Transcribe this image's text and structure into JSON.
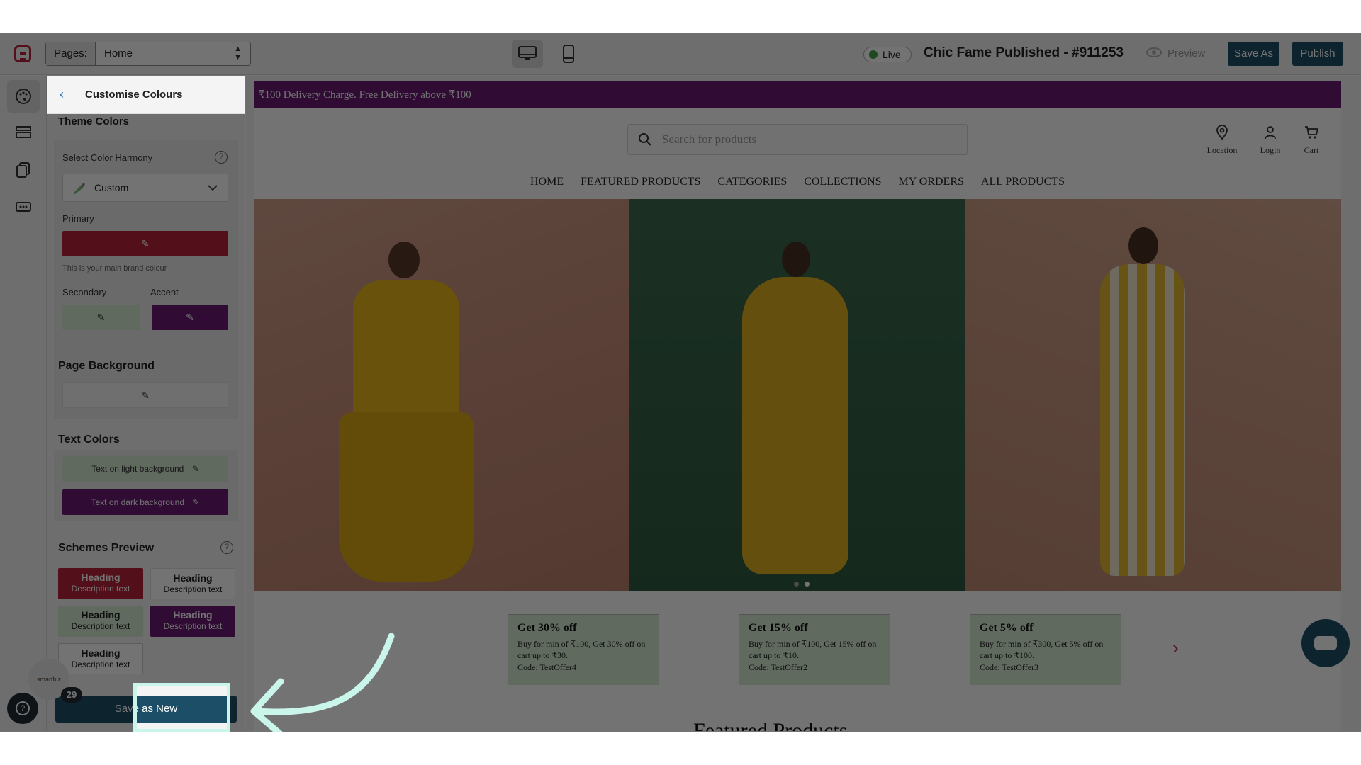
{
  "topbar": {
    "pages_label": "Pages:",
    "page_value": "Home",
    "live_label": "Live",
    "store_title": "Chic Fame Published - #911253",
    "preview_label": "Preview",
    "save_as_label": "Save As",
    "publish_label": "Publish"
  },
  "panel": {
    "title": "Customise Colours",
    "section_cut": "Theme Colors",
    "harmony_label": "Select Color Harmony",
    "harmony_value": "Custom",
    "primary_label": "Primary",
    "primary_hint": "This is your main brand colour",
    "secondary_label": "Secondary",
    "accent_label": "Accent",
    "page_bg_title": "Page Background",
    "text_colors_title": "Text Colors",
    "text_light": "Text on light background",
    "text_dark": "Text on dark background",
    "schemes_title": "Schemes Preview",
    "schemes": [
      {
        "heading": "Heading",
        "desc": "Description text"
      },
      {
        "heading": "Heading",
        "desc": "Description text"
      },
      {
        "heading": "Heading",
        "desc": "Description text"
      },
      {
        "heading": "Heading",
        "desc": "Description text"
      },
      {
        "heading": "Heading",
        "desc": "Description text"
      }
    ],
    "save_new_label": "Save as New",
    "avatar_text": "smartbiz",
    "badge_count": "29"
  },
  "colors": {
    "primary": "#b8243a",
    "secondary": "#d6ecd2",
    "accent": "#6a1c77",
    "brand_dark": "#1d4e67",
    "live_green": "#43a047"
  },
  "site": {
    "promo": "₹100 Delivery Charge. Free Delivery above ₹100",
    "search_placeholder": "Search for products",
    "header_icons": [
      {
        "icon": "location-icon",
        "label": "Location"
      },
      {
        "icon": "user-icon",
        "label": "Login"
      },
      {
        "icon": "cart-icon",
        "label": "Cart"
      }
    ],
    "nav": [
      "HOME",
      "FEATURED PRODUCTS",
      "CATEGORIES",
      "COLLECTIONS",
      "MY ORDERS",
      "ALL PRODUCTS"
    ],
    "offers": [
      {
        "title": "Get 30% off",
        "body": "Buy for min of ₹100, Get 30% off on cart up to ₹30.",
        "code": "Code: TestOffer4"
      },
      {
        "title": "Get 15% off",
        "body": "Buy for min of ₹100, Get 15% off on cart up to ₹10.",
        "code": "Code: TestOffer2"
      },
      {
        "title": "Get 5% off",
        "body": "Buy for min of ₹300, Get 5% off on cart up to ₹100.",
        "code": "Code: TestOffer3"
      }
    ],
    "featured_cut": "Featured Products"
  }
}
